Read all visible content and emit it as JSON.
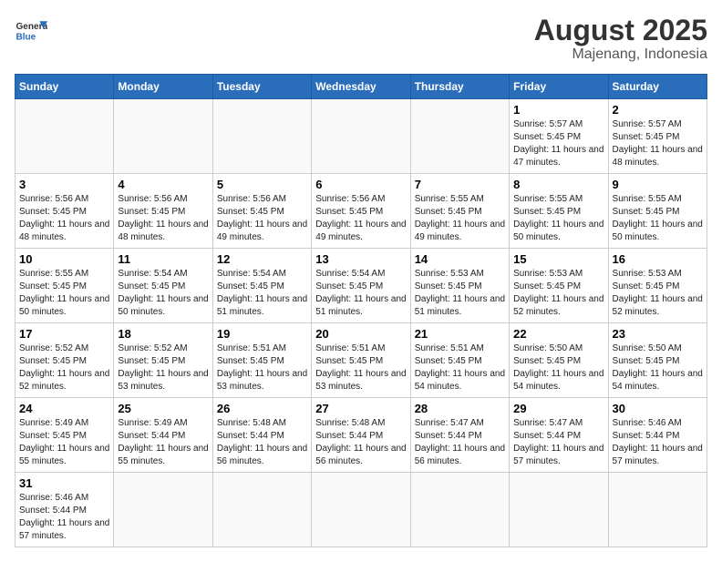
{
  "logo": {
    "general": "General",
    "blue": "Blue"
  },
  "title": {
    "month": "August 2025",
    "location": "Majenang, Indonesia"
  },
  "weekdays": [
    "Sunday",
    "Monday",
    "Tuesday",
    "Wednesday",
    "Thursday",
    "Friday",
    "Saturday"
  ],
  "weeks": [
    [
      {
        "day": "",
        "info": ""
      },
      {
        "day": "",
        "info": ""
      },
      {
        "day": "",
        "info": ""
      },
      {
        "day": "",
        "info": ""
      },
      {
        "day": "",
        "info": ""
      },
      {
        "day": "1",
        "info": "Sunrise: 5:57 AM\nSunset: 5:45 PM\nDaylight: 11 hours\nand 47 minutes."
      },
      {
        "day": "2",
        "info": "Sunrise: 5:57 AM\nSunset: 5:45 PM\nDaylight: 11 hours\nand 48 minutes."
      }
    ],
    [
      {
        "day": "3",
        "info": "Sunrise: 5:56 AM\nSunset: 5:45 PM\nDaylight: 11 hours\nand 48 minutes."
      },
      {
        "day": "4",
        "info": "Sunrise: 5:56 AM\nSunset: 5:45 PM\nDaylight: 11 hours\nand 48 minutes."
      },
      {
        "day": "5",
        "info": "Sunrise: 5:56 AM\nSunset: 5:45 PM\nDaylight: 11 hours\nand 49 minutes."
      },
      {
        "day": "6",
        "info": "Sunrise: 5:56 AM\nSunset: 5:45 PM\nDaylight: 11 hours\nand 49 minutes."
      },
      {
        "day": "7",
        "info": "Sunrise: 5:55 AM\nSunset: 5:45 PM\nDaylight: 11 hours\nand 49 minutes."
      },
      {
        "day": "8",
        "info": "Sunrise: 5:55 AM\nSunset: 5:45 PM\nDaylight: 11 hours\nand 50 minutes."
      },
      {
        "day": "9",
        "info": "Sunrise: 5:55 AM\nSunset: 5:45 PM\nDaylight: 11 hours\nand 50 minutes."
      }
    ],
    [
      {
        "day": "10",
        "info": "Sunrise: 5:55 AM\nSunset: 5:45 PM\nDaylight: 11 hours\nand 50 minutes."
      },
      {
        "day": "11",
        "info": "Sunrise: 5:54 AM\nSunset: 5:45 PM\nDaylight: 11 hours\nand 50 minutes."
      },
      {
        "day": "12",
        "info": "Sunrise: 5:54 AM\nSunset: 5:45 PM\nDaylight: 11 hours\nand 51 minutes."
      },
      {
        "day": "13",
        "info": "Sunrise: 5:54 AM\nSunset: 5:45 PM\nDaylight: 11 hours\nand 51 minutes."
      },
      {
        "day": "14",
        "info": "Sunrise: 5:53 AM\nSunset: 5:45 PM\nDaylight: 11 hours\nand 51 minutes."
      },
      {
        "day": "15",
        "info": "Sunrise: 5:53 AM\nSunset: 5:45 PM\nDaylight: 11 hours\nand 52 minutes."
      },
      {
        "day": "16",
        "info": "Sunrise: 5:53 AM\nSunset: 5:45 PM\nDaylight: 11 hours\nand 52 minutes."
      }
    ],
    [
      {
        "day": "17",
        "info": "Sunrise: 5:52 AM\nSunset: 5:45 PM\nDaylight: 11 hours\nand 52 minutes."
      },
      {
        "day": "18",
        "info": "Sunrise: 5:52 AM\nSunset: 5:45 PM\nDaylight: 11 hours\nand 53 minutes."
      },
      {
        "day": "19",
        "info": "Sunrise: 5:51 AM\nSunset: 5:45 PM\nDaylight: 11 hours\nand 53 minutes."
      },
      {
        "day": "20",
        "info": "Sunrise: 5:51 AM\nSunset: 5:45 PM\nDaylight: 11 hours\nand 53 minutes."
      },
      {
        "day": "21",
        "info": "Sunrise: 5:51 AM\nSunset: 5:45 PM\nDaylight: 11 hours\nand 54 minutes."
      },
      {
        "day": "22",
        "info": "Sunrise: 5:50 AM\nSunset: 5:45 PM\nDaylight: 11 hours\nand 54 minutes."
      },
      {
        "day": "23",
        "info": "Sunrise: 5:50 AM\nSunset: 5:45 PM\nDaylight: 11 hours\nand 54 minutes."
      }
    ],
    [
      {
        "day": "24",
        "info": "Sunrise: 5:49 AM\nSunset: 5:45 PM\nDaylight: 11 hours\nand 55 minutes."
      },
      {
        "day": "25",
        "info": "Sunrise: 5:49 AM\nSunset: 5:44 PM\nDaylight: 11 hours\nand 55 minutes."
      },
      {
        "day": "26",
        "info": "Sunrise: 5:48 AM\nSunset: 5:44 PM\nDaylight: 11 hours\nand 56 minutes."
      },
      {
        "day": "27",
        "info": "Sunrise: 5:48 AM\nSunset: 5:44 PM\nDaylight: 11 hours\nand 56 minutes."
      },
      {
        "day": "28",
        "info": "Sunrise: 5:47 AM\nSunset: 5:44 PM\nDaylight: 11 hours\nand 56 minutes."
      },
      {
        "day": "29",
        "info": "Sunrise: 5:47 AM\nSunset: 5:44 PM\nDaylight: 11 hours\nand 57 minutes."
      },
      {
        "day": "30",
        "info": "Sunrise: 5:46 AM\nSunset: 5:44 PM\nDaylight: 11 hours\nand 57 minutes."
      }
    ],
    [
      {
        "day": "31",
        "info": "Sunrise: 5:46 AM\nSunset: 5:44 PM\nDaylight: 11 hours\nand 57 minutes."
      },
      {
        "day": "",
        "info": ""
      },
      {
        "day": "",
        "info": ""
      },
      {
        "day": "",
        "info": ""
      },
      {
        "day": "",
        "info": ""
      },
      {
        "day": "",
        "info": ""
      },
      {
        "day": "",
        "info": ""
      }
    ]
  ]
}
